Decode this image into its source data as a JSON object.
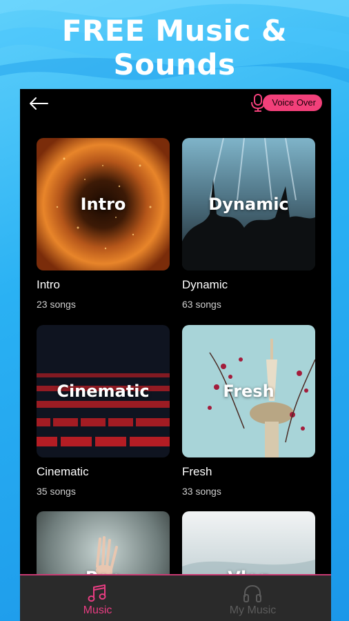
{
  "promo": {
    "line1": "FREE Music &",
    "line2": "Sounds"
  },
  "header": {
    "back_icon": "arrow-left-icon",
    "voice_over_label": "Voice Over",
    "voice_icon": "microphone-icon"
  },
  "categories": [
    {
      "thumb_label": "Intro",
      "title": "Intro",
      "count": "23 songs"
    },
    {
      "thumb_label": "Dynamic",
      "title": "Dynamic",
      "count": "63 songs"
    },
    {
      "thumb_label": "Cinematic",
      "title": "Cinematic",
      "count": "35 songs"
    },
    {
      "thumb_label": "Fresh",
      "title": "Fresh",
      "count": "33 songs"
    },
    {
      "thumb_label": "Pop",
      "title": "",
      "count": ""
    },
    {
      "thumb_label": "Vlog",
      "title": "",
      "count": ""
    }
  ],
  "bottom_nav": [
    {
      "label": "Music",
      "icon": "music-note-icon",
      "active": true
    },
    {
      "label": "My Music",
      "icon": "headphones-icon",
      "active": false
    }
  ],
  "colors": {
    "accent": "#f2407a",
    "background_blue": "#2ab1f3",
    "active_tab": "#e83d82",
    "inactive_tab": "#5c5c5c"
  }
}
